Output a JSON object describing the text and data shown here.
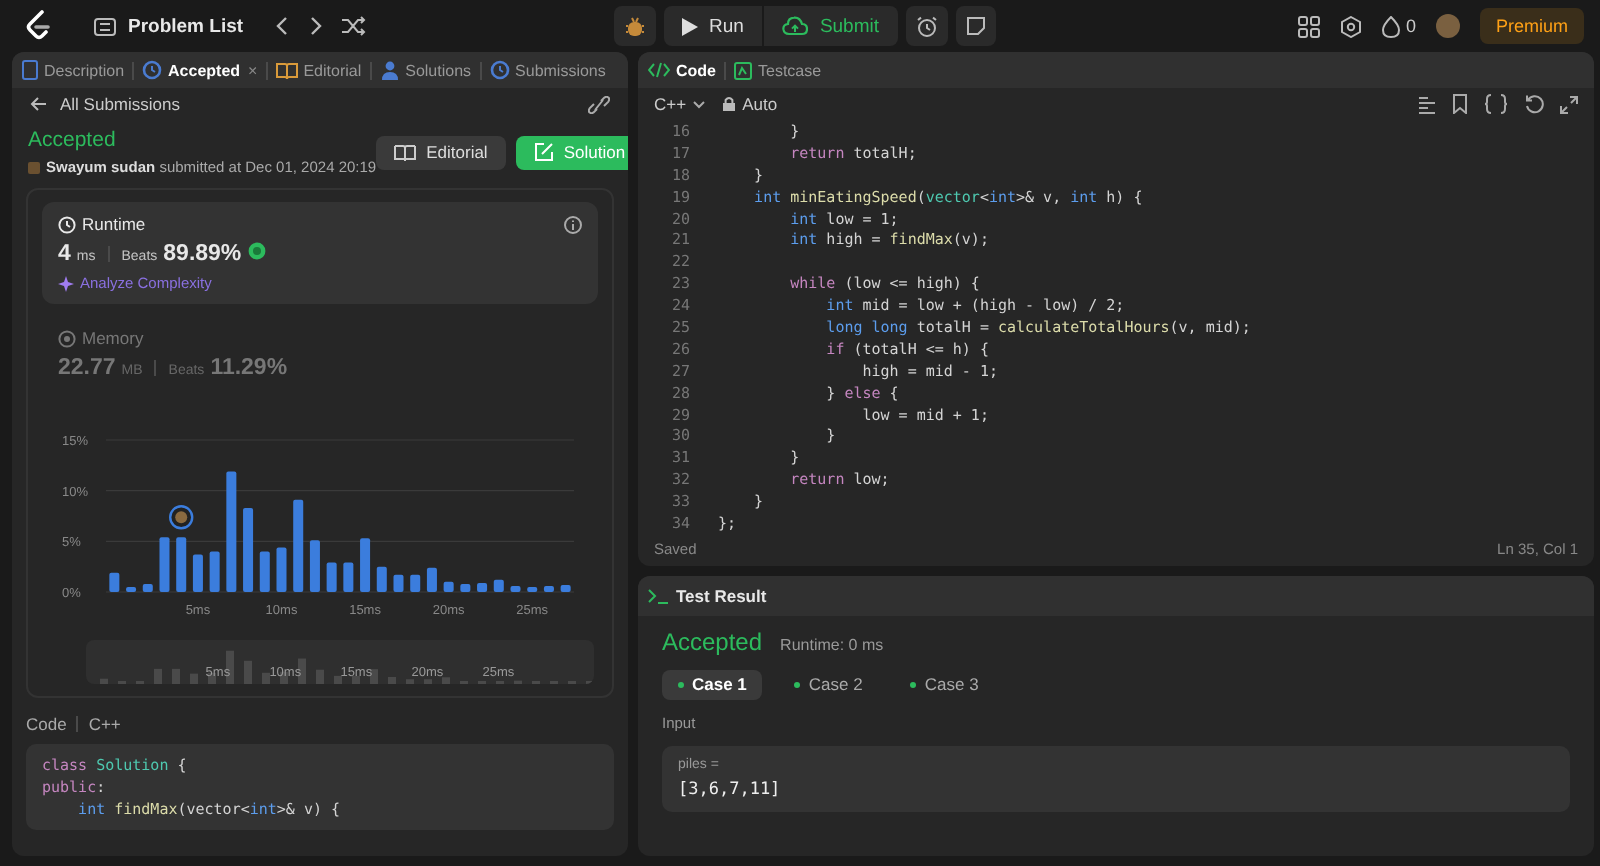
{
  "top_bar": {
    "title": "Problem List",
    "run": "Run",
    "submit": "Submit",
    "streak": "0",
    "premium": "Premium"
  },
  "left_tabs": [
    {
      "label": "Description",
      "selected": false
    },
    {
      "label": "Accepted",
      "selected": true,
      "close": "×"
    },
    {
      "label": "Editorial",
      "selected": false
    },
    {
      "label": "Solutions",
      "selected": false
    },
    {
      "label": "Submissions",
      "selected": false
    }
  ],
  "back_link": "All Submissions",
  "submission": {
    "status": "Accepted",
    "byline": "**Swayum sudan** submitted at Dec 01, 2024 20:19",
    "buttons": [
      {
        "label": "Editorial",
        "kind": "secondary"
      },
      {
        "label": "Solution",
        "kind": "primary"
      }
    ]
  },
  "metrics": [
    {
      "title": "Runtime",
      "value": "4",
      "unit": "ms",
      "beats_label": "Beats",
      "beats": "89.89%",
      "selected": true,
      "link": "Analyze Complexity"
    },
    {
      "title": "Memory",
      "value": "22.77",
      "unit": "MB",
      "beats_label": "Beats",
      "beats": "11.29%",
      "selected": false
    }
  ],
  "chart_data": {
    "type": "bar",
    "x": [
      0,
      1,
      2,
      3,
      4,
      5,
      6,
      7,
      8,
      9,
      10,
      11,
      12,
      13,
      14,
      15,
      16,
      17,
      18,
      19,
      20,
      21,
      22,
      23,
      24,
      25,
      26,
      27
    ],
    "values": [
      1.9,
      0.5,
      0.8,
      5.4,
      5.4,
      3.7,
      4.0,
      11.9,
      8.3,
      4.0,
      4.4,
      9.1,
      5.1,
      2.9,
      2.9,
      5.3,
      2.5,
      1.7,
      1.7,
      2.4,
      1.0,
      0.8,
      0.9,
      1.2,
      0.6,
      0.5,
      0.6,
      0.7
    ],
    "xlim": [
      -0.5,
      27.5
    ],
    "ylim": [
      0,
      15
    ],
    "yticks": [
      {
        "value": 0,
        "label": "0%"
      },
      {
        "value": 5,
        "label": "5%"
      },
      {
        "value": 10,
        "label": "10%"
      },
      {
        "value": 15,
        "label": "15%"
      }
    ],
    "xticks": [
      {
        "value": 5,
        "label": "5ms"
      },
      {
        "value": 10,
        "label": "10ms"
      },
      {
        "value": 15,
        "label": "15ms"
      },
      {
        "value": 20,
        "label": "20ms"
      },
      {
        "value": 25,
        "label": "25ms"
      }
    ]
  },
  "overview_labels": [
    "5ms",
    "10ms",
    "15ms",
    "20ms",
    "25ms"
  ],
  "code_header": {
    "label": "Code",
    "language": "C++"
  },
  "submitted_code": [
    {
      "segments": [
        {
          "kind": "ctl",
          "text": "class"
        },
        {
          "kind": "ty",
          "text": " Solution"
        },
        {
          "kind": "p",
          "text": " {"
        }
      ]
    },
    {
      "segments": [
        {
          "kind": "ctl",
          "text": "public"
        },
        {
          "kind": "p",
          "text": ":"
        }
      ]
    },
    {
      "segments": [
        {
          "kind": "kw",
          "text": "    int"
        },
        {
          "kind": "fn",
          "text": " findMax"
        },
        {
          "kind": "p",
          "text": "(vector<"
        },
        {
          "kind": "kw",
          "text": "int"
        },
        {
          "kind": "p",
          "text": ">& v) {"
        }
      ]
    }
  ],
  "editor": {
    "tabs": [
      {
        "label": "Code",
        "selected": true
      },
      {
        "label": "Testcase",
        "selected": false
      }
    ],
    "language": "C++",
    "mode": "Auto",
    "lines": [
      {
        "n": "16",
        "segments": [
          {
            "kind": "p",
            "text": "        }"
          }
        ]
      },
      {
        "n": "17",
        "segments": [
          {
            "kind": "ctl",
            "text": "        return"
          },
          {
            "kind": "p",
            "text": " totalH;"
          }
        ]
      },
      {
        "n": "18",
        "segments": [
          {
            "kind": "p",
            "text": "    }"
          }
        ]
      },
      {
        "n": "19",
        "segments": [
          {
            "kind": "kw",
            "text": "    int"
          },
          {
            "kind": "fn",
            "text": " minEatingSpeed"
          },
          {
            "kind": "p",
            "text": "("
          },
          {
            "kind": "ty",
            "text": "vector"
          },
          {
            "kind": "p",
            "text": "<"
          },
          {
            "kind": "kw",
            "text": "int"
          },
          {
            "kind": "p",
            "text": ">& v, "
          },
          {
            "kind": "kw",
            "text": "int"
          },
          {
            "kind": "p",
            "text": " h) {"
          }
        ]
      },
      {
        "n": "20",
        "segments": [
          {
            "kind": "kw",
            "text": "        int"
          },
          {
            "kind": "p",
            "text": " low = 1;"
          }
        ]
      },
      {
        "n": "21",
        "segments": [
          {
            "kind": "kw",
            "text": "        int"
          },
          {
            "kind": "p",
            "text": " high = "
          },
          {
            "kind": "fn",
            "text": "findMax"
          },
          {
            "kind": "p",
            "text": "(v);"
          }
        ]
      },
      {
        "n": "22"
      },
      {
        "n": "23",
        "segments": [
          {
            "kind": "ctl",
            "text": "        while"
          },
          {
            "kind": "p",
            "text": " (low <= high) {"
          }
        ]
      },
      {
        "n": "24",
        "segments": [
          {
            "kind": "kw",
            "text": "            int"
          },
          {
            "kind": "p",
            "text": " mid = low + (high - low) / 2;"
          }
        ]
      },
      {
        "n": "25",
        "segments": [
          {
            "kind": "kw",
            "text": "            long long"
          },
          {
            "kind": "p",
            "text": " totalH = "
          },
          {
            "kind": "fn",
            "text": "calculateTotalHours"
          },
          {
            "kind": "p",
            "text": "(v, mid);"
          }
        ]
      },
      {
        "n": "26",
        "segments": [
          {
            "kind": "ctl",
            "text": "            if"
          },
          {
            "kind": "p",
            "text": " (totalH <= h) {"
          }
        ]
      },
      {
        "n": "27",
        "segments": [
          {
            "kind": "p",
            "text": "                high = mid - 1;"
          }
        ]
      },
      {
        "n": "28",
        "segments": [
          {
            "kind": "p",
            "text": "            } "
          },
          {
            "kind": "ctl",
            "text": "else"
          },
          {
            "kind": "p",
            "text": " {"
          }
        ]
      },
      {
        "n": "29",
        "segments": [
          {
            "kind": "p",
            "text": "                low = mid + 1;"
          }
        ]
      },
      {
        "n": "30",
        "segments": [
          {
            "kind": "p",
            "text": "            }"
          }
        ]
      },
      {
        "n": "31",
        "segments": [
          {
            "kind": "p",
            "text": "        }"
          }
        ]
      },
      {
        "n": "32",
        "segments": [
          {
            "kind": "ctl",
            "text": "        return"
          },
          {
            "kind": "p",
            "text": " low;"
          }
        ]
      },
      {
        "n": "33",
        "segments": [
          {
            "kind": "p",
            "text": "    }"
          }
        ]
      },
      {
        "n": "34",
        "segments": [
          {
            "kind": "p",
            "text": "};"
          }
        ]
      }
    ],
    "status": "Saved",
    "cursor": "Ln 35, Col 1"
  },
  "test_result": {
    "title": "Test Result",
    "status": "Accepted",
    "runtime": "Runtime: 0 ms",
    "cases": [
      {
        "label": "Case 1",
        "selected": true
      },
      {
        "label": "Case 2",
        "selected": false
      },
      {
        "label": "Case 3",
        "selected": false
      }
    ],
    "input_label": "Input",
    "param": "piles =",
    "value": "[3,6,7,11]"
  }
}
